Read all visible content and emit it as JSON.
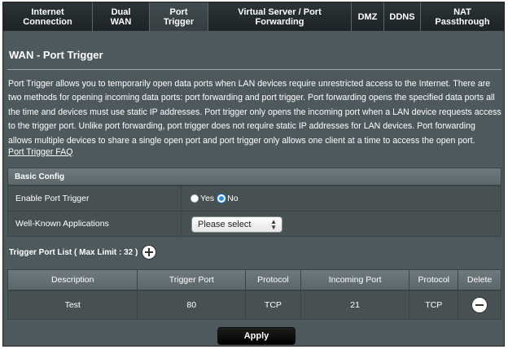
{
  "tabs": [
    {
      "label": "Internet\nConnection"
    },
    {
      "label": "Dual\nWAN"
    },
    {
      "label": "Port\nTrigger"
    },
    {
      "label": "Virtual Server / Port\nForwarding"
    },
    {
      "label": "DMZ"
    },
    {
      "label": "DDNS"
    },
    {
      "label": "NAT\nPassthrough"
    }
  ],
  "active_tab": "Port Trigger",
  "page_title": "WAN - Port Trigger",
  "description": "Port Trigger allows you to temporarily open data ports when LAN devices require unrestricted access to the Internet. There are two methods for opening incoming data ports: port forwarding and port trigger. Port forwarding opens the specified data ports all the time and devices must use static IP addresses. Port trigger only opens the incoming port when a LAN device requests access to the trigger port. Unlike port forwarding, port trigger does not require static IP addresses for LAN devices. Port forwarding allows multiple devices to share a single open port and port trigger only allows one client at a time to access the open port.",
  "faq_link": "Port Trigger FAQ",
  "basic_config": {
    "header": "Basic Config",
    "enable_label": "Enable Port Trigger",
    "yes_label": "Yes",
    "no_label": "No",
    "enable_value": "No",
    "apps_label": "Well-Known Applications",
    "apps_select": "Please select"
  },
  "trigger_list": {
    "title": "Trigger Port List ( Max Limit : 32 )",
    "columns": [
      "Description",
      "Trigger Port",
      "Protocol",
      "Incoming Port",
      "Protocol",
      "Delete"
    ],
    "rows": [
      {
        "description": "Test",
        "trigger_port": "80",
        "trigger_protocol": "TCP",
        "incoming_port": "21",
        "incoming_protocol": "TCP"
      }
    ]
  },
  "apply_label": "Apply",
  "icons": {
    "add": "plus-circle-icon",
    "delete": "minus-circle-icon"
  }
}
